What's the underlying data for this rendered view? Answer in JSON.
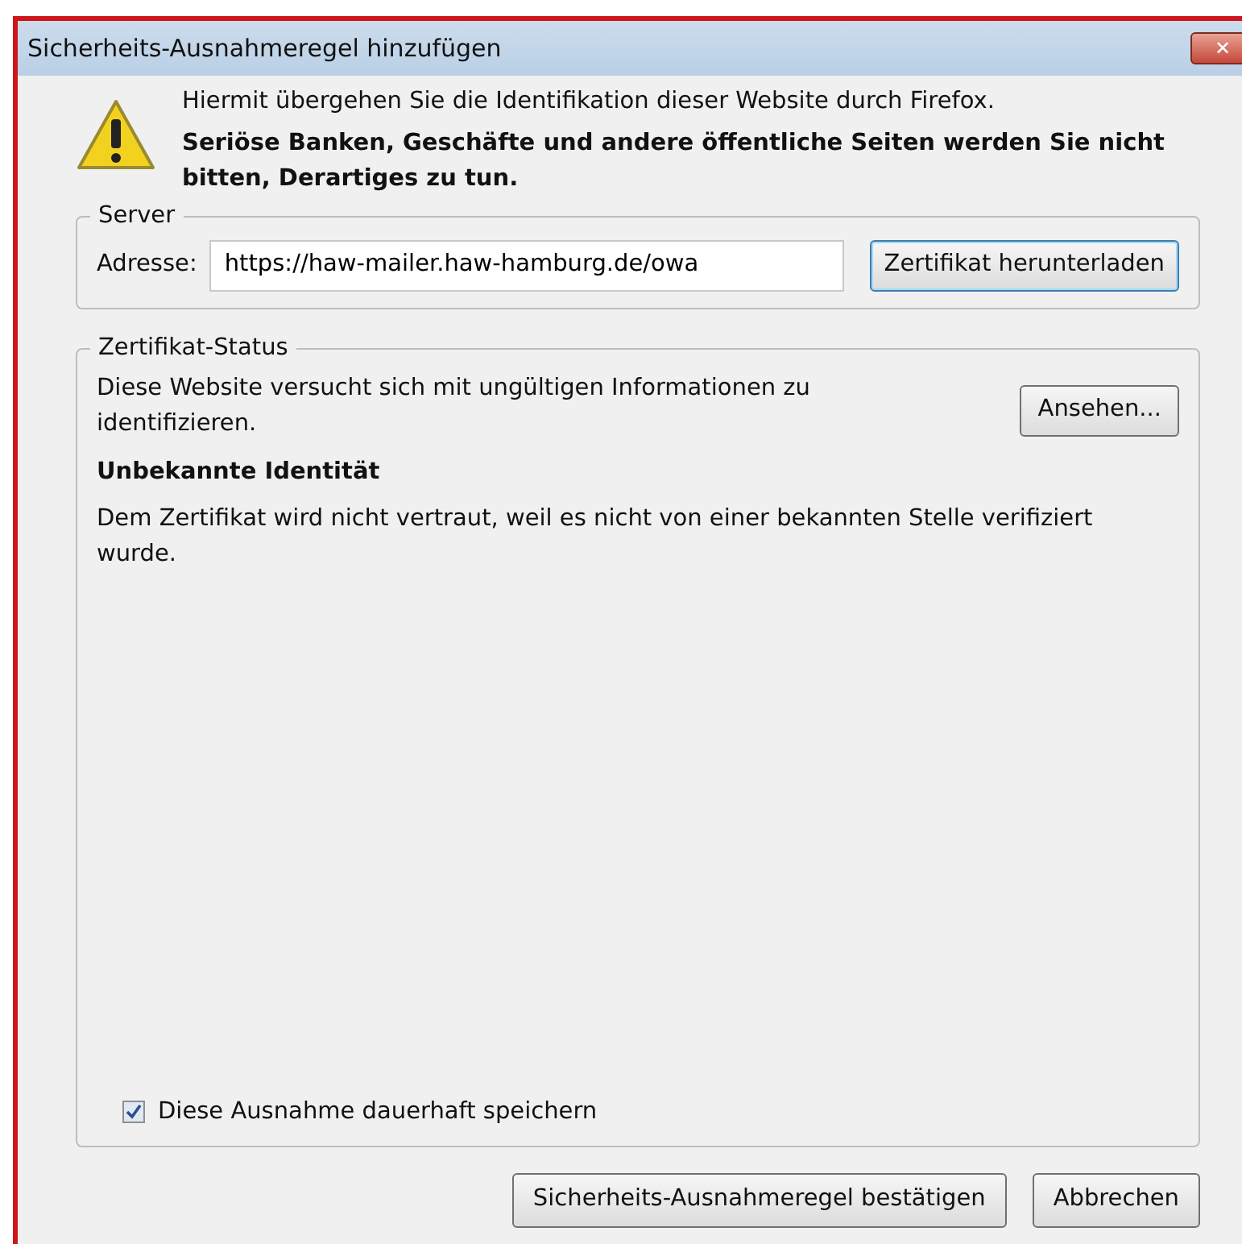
{
  "window": {
    "title": "Sicherheits-Ausnahmeregel hinzufügen",
    "close": "✕"
  },
  "warning": {
    "text": "Hiermit übergehen Sie die Identifikation dieser Website durch Firefox.",
    "bold_text": "Seriöse Banken, Geschäfte und andere öffentliche Seiten werden Sie nicht bitten, Derartiges zu tun."
  },
  "server": {
    "legend": "Server",
    "label": "Adresse:",
    "value": "https://haw-mailer.haw-hamburg.de/owa",
    "button": "Zertifikat herunterladen"
  },
  "status": {
    "legend": "Zertifikat-Status",
    "text": "Diese Website versucht sich mit ungültigen Informationen zu identifizieren.",
    "button": "Ansehen...",
    "heading": "Unbekannte Identität",
    "detail": "Dem Zertifikat wird nicht vertraut, weil es nicht von einer bekannten Stelle verifiziert wurde."
  },
  "permanent": {
    "label": "Diese Ausnahme dauerhaft speichern",
    "checked": true
  },
  "buttons": [
    "Sicherheits-Ausnahmeregel bestätigen",
    "Abbrechen"
  ]
}
